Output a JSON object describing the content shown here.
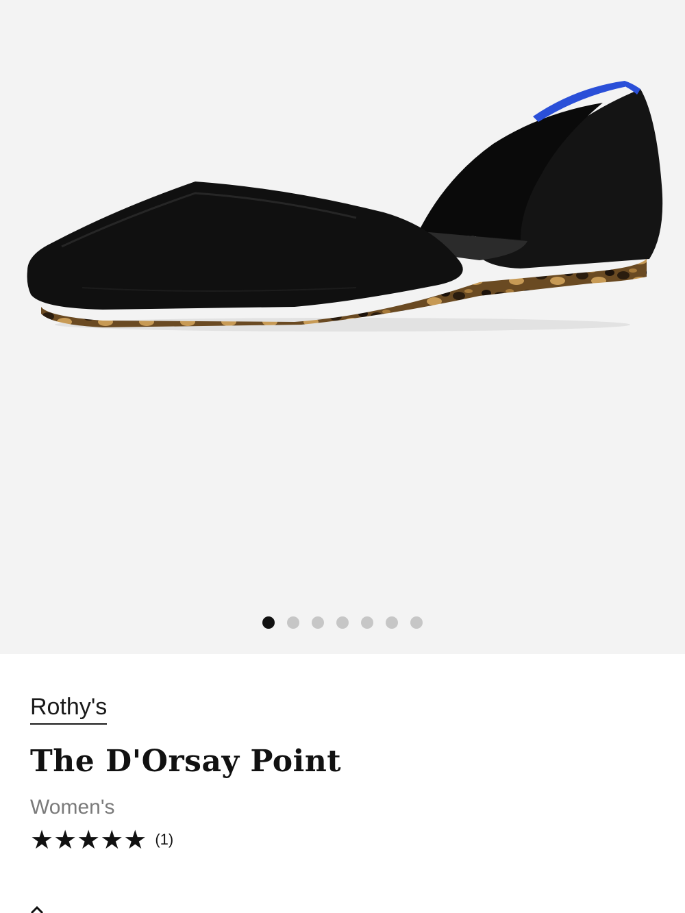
{
  "gallery": {
    "image_alt": "Black knit pointed-toe d'Orsay flat with blue heel binding and tortoiseshell sole",
    "slide_count": 7,
    "active_slide": 1,
    "colors": {
      "background": "#f3f3f3",
      "active_dot": "#111111",
      "inactive_dot": "#c6c6c6",
      "accent_blue": "#2a4fd8"
    }
  },
  "product": {
    "brand": "Rothy's",
    "name": "The D'Orsay Point",
    "category": "Women's",
    "rating": 5,
    "rating_display": "★★★★★",
    "review_count": "(1)"
  }
}
